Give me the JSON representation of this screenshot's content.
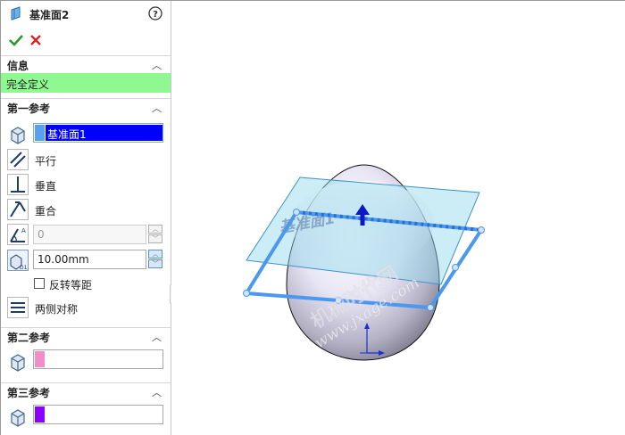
{
  "title": "基准面2",
  "status": "完全定义",
  "sections": {
    "info": "信息",
    "first": "第一参考",
    "second": "第二参考",
    "third": "第三参考"
  },
  "first_ref": {
    "selected": "基准面1",
    "parallel": "平行",
    "perpendicular": "垂直",
    "coincident": "重合",
    "angle_value": "0",
    "distance_value": "10.00mm",
    "flip": "反转等距",
    "mid_plane": "两侧对称"
  },
  "viewport": {
    "plane_label": "基准面1",
    "watermark_1": "机械时代网",
    "watermark_2": "www.jxage.com"
  },
  "colors": {
    "status_bg": "#90F890",
    "selection_bg": "#0000FF",
    "first_swatch": "#5AA0F0",
    "second_swatch": "#F48CC8",
    "third_swatch": "#8A00FF"
  },
  "icons": [
    "plane-icon",
    "help-icon",
    "ok-icon",
    "cancel-icon",
    "face-select-icon",
    "parallel-icon",
    "perpendicular-icon",
    "coincident-icon",
    "angle-icon",
    "distance-icon",
    "mid-plane-icon",
    "chevron-up-icon"
  ]
}
